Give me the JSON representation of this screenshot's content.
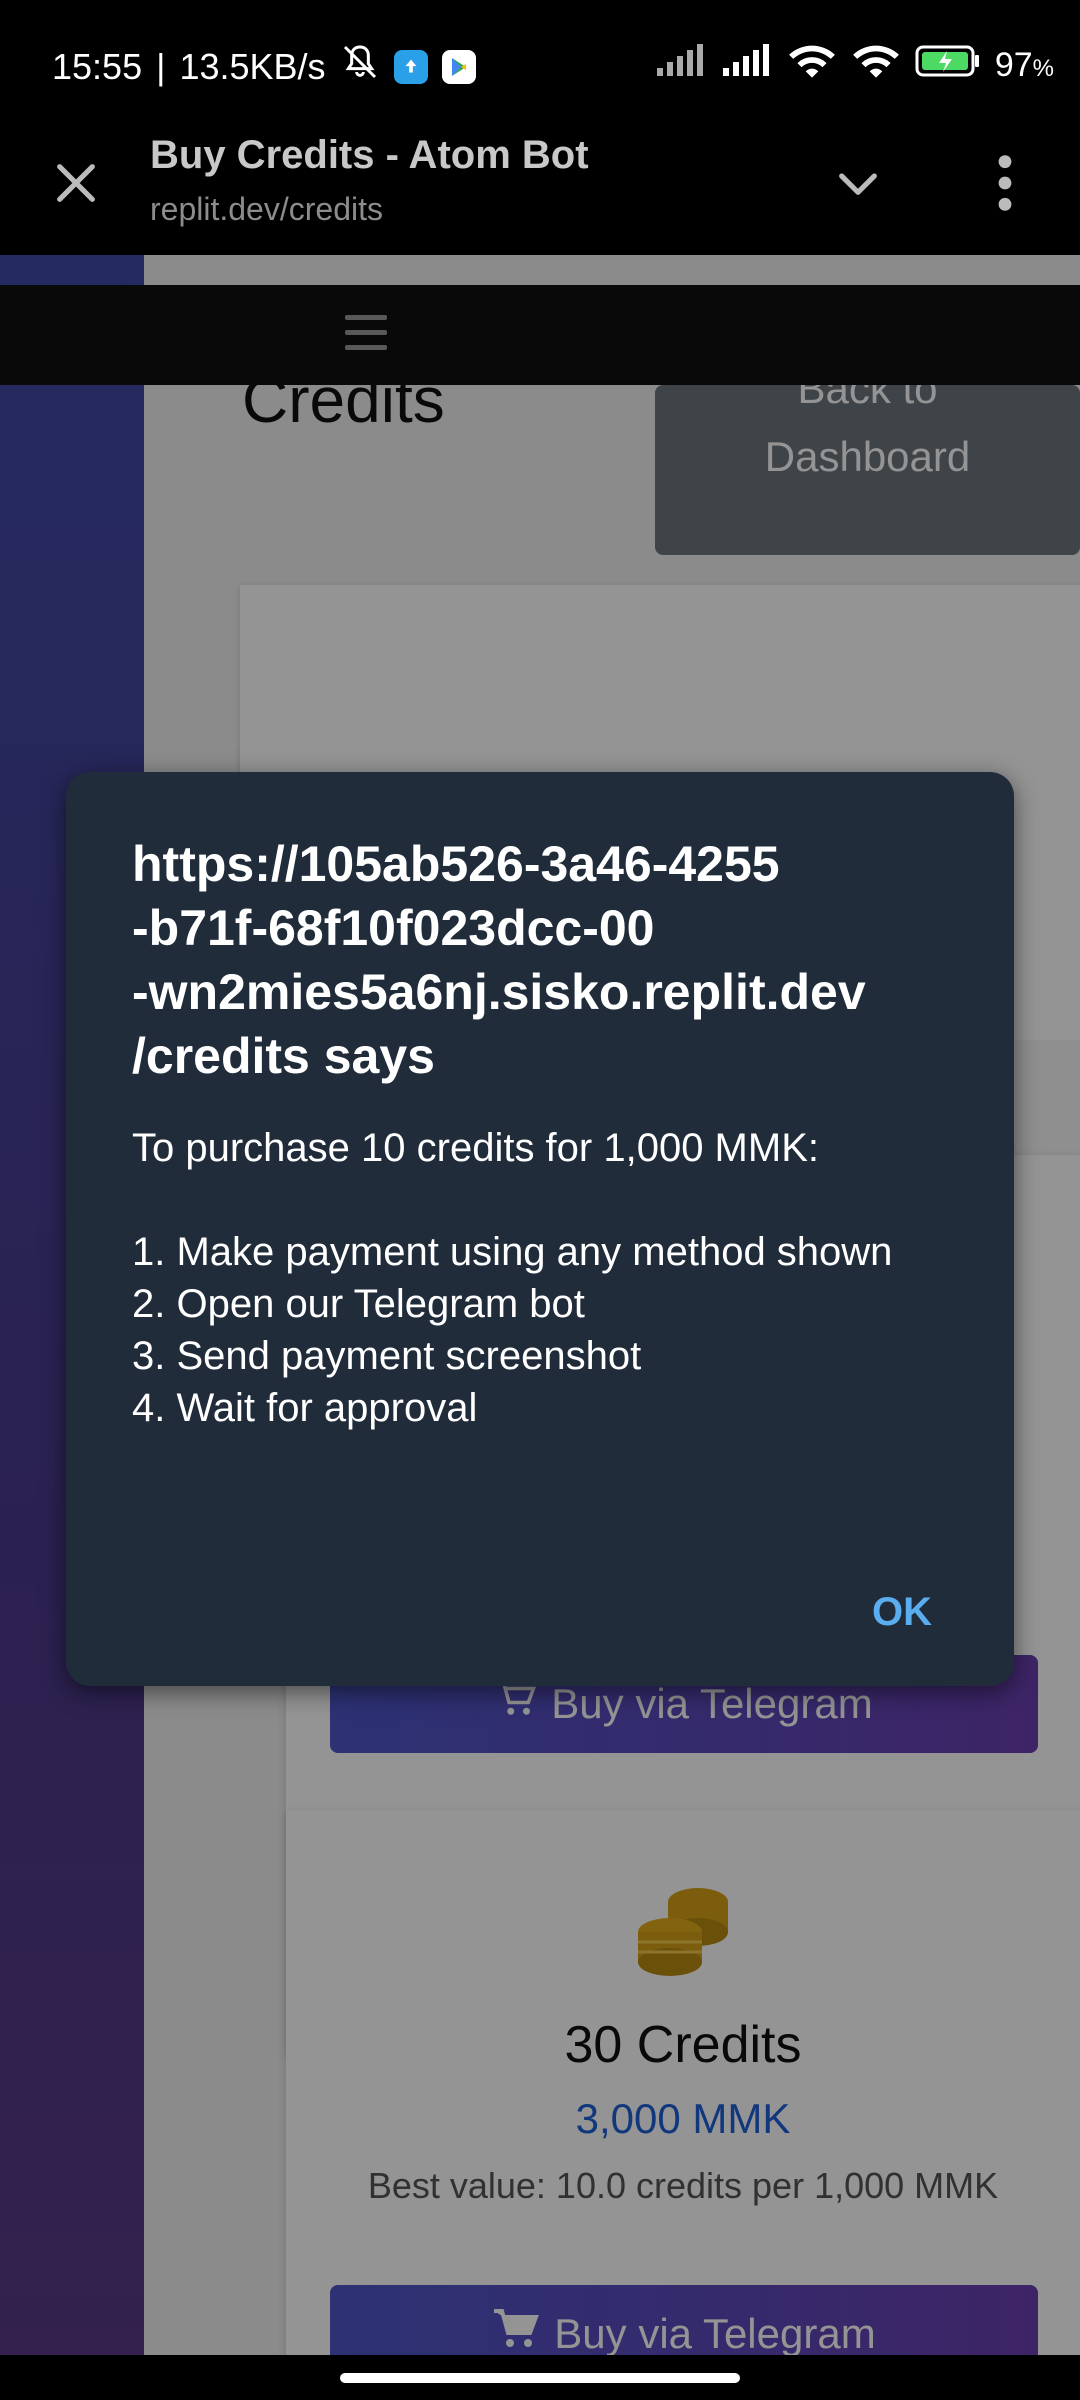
{
  "status_bar": {
    "time": "15:55",
    "speed": "13.5KB/s",
    "battery": "97",
    "battery_unit": "%"
  },
  "tab": {
    "title": "Buy Credits - Atom Bot",
    "url": "replit.dev/credits"
  },
  "page": {
    "heading": "Credits",
    "back_line1": "Back to",
    "back_line2": "Dashboard",
    "buy_button_label": "Buy via Telegram",
    "package": {
      "title": "30 Credits",
      "price": "3,000 MMK",
      "note": "Best value: 10.0 credits per 1,000 MMK"
    }
  },
  "dialog": {
    "title_lines": [
      "https://105ab526-3a46-4255",
      "-b71f-68f10f023dcc-00",
      "-wn2mies5a6nj.sisko.replit.dev",
      "/credits says"
    ],
    "intro": "To purchase 10 credits for 1,000 MMK:",
    "steps": [
      "1. Make payment using any method shown",
      "2. Open our Telegram bot",
      "3. Send payment screenshot",
      "4. Wait for approval"
    ],
    "ok_label": "OK"
  },
  "colors": {
    "dialog_bg": "#212c3b",
    "ok_accent": "#5aaef0",
    "price_blue": "#1e5fd6",
    "coin_gold": "#d4a017"
  },
  "icons": [
    "mute-icon",
    "upload-app-icon",
    "play-store-icon",
    "signal-icon",
    "wifi-icon",
    "battery-icon",
    "close-icon",
    "chevron-down-icon",
    "more-vert-icon",
    "menu-icon",
    "cart-icon",
    "coins-icon"
  ]
}
